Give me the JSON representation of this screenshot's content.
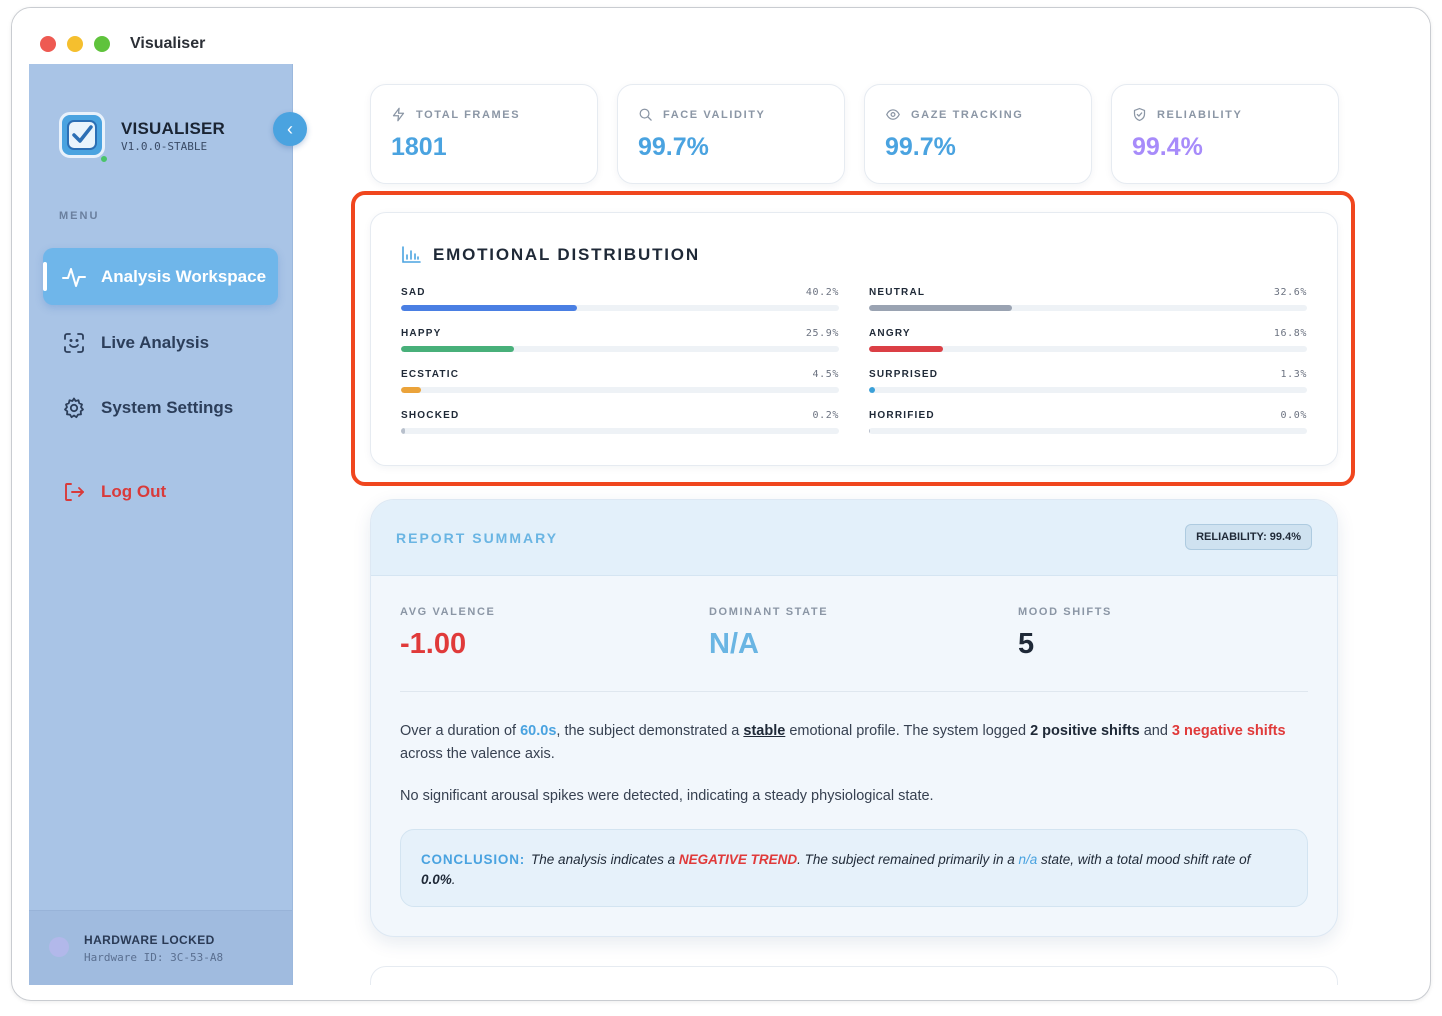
{
  "window": {
    "title": "Visualiser"
  },
  "sidebar": {
    "brand": "VISUALISER",
    "version": "V1.0.0-STABLE",
    "collapse_icon": "chevron-left-icon",
    "menu_label": "MENU",
    "items": [
      {
        "label": "Analysis Workspace",
        "icon": "activity-icon",
        "active": true
      },
      {
        "label": "Live Analysis",
        "icon": "face-scan-icon",
        "active": false
      },
      {
        "label": "System Settings",
        "icon": "gear-icon",
        "active": false
      }
    ],
    "logout": {
      "label": "Log Out",
      "icon": "logout-icon"
    },
    "hardware": {
      "title": "HARDWARE LOCKED",
      "id": "Hardware ID: 3C-53-A8"
    }
  },
  "stats": [
    {
      "label": "TOTAL FRAMES",
      "value": "1801",
      "icon": "lightning-icon",
      "color": "#4aa3e0"
    },
    {
      "label": "FACE VALIDITY",
      "value": "99.7%",
      "icon": "search-icon",
      "color": "#4aa3e0"
    },
    {
      "label": "GAZE TRACKING",
      "value": "99.7%",
      "icon": "eye-icon",
      "color": "#4aa3e0"
    },
    {
      "label": "RELIABILITY",
      "value": "99.4%",
      "icon": "shield-check-icon",
      "color": "#a78bfa"
    }
  ],
  "emotions": {
    "title": "EMOTIONAL DISTRIBUTION",
    "icon": "bar-chart-icon",
    "items": [
      {
        "label": "SAD",
        "percent": "40.2%",
        "value": 40.2,
        "color": "#4a7fe3"
      },
      {
        "label": "NEUTRAL",
        "percent": "32.6%",
        "value": 32.6,
        "color": "#9aa3b2"
      },
      {
        "label": "HAPPY",
        "percent": "25.9%",
        "value": 25.9,
        "color": "#48b07a"
      },
      {
        "label": "ANGRY",
        "percent": "16.8%",
        "value": 16.8,
        "color": "#db3f45"
      },
      {
        "label": "ECSTATIC",
        "percent": "4.5%",
        "value": 4.5,
        "color": "#eba33a"
      },
      {
        "label": "SURPRISED",
        "percent": "1.3%",
        "value": 1.3,
        "color": "#3aa0d8"
      },
      {
        "label": "SHOCKED",
        "percent": "0.2%",
        "value": 0.2,
        "color": "#b8c0cc"
      },
      {
        "label": "HORRIFIED",
        "percent": "0.0%",
        "value": 0.0,
        "color": "#b8c0cc"
      }
    ]
  },
  "report": {
    "title": "REPORT SUMMARY",
    "reliability_badge": "RELIABILITY: 99.4%",
    "metrics": [
      {
        "label": "AVG VALENCE",
        "value": "-1.00",
        "color": "#e03a3a"
      },
      {
        "label": "DOMINANT STATE",
        "value": "N/A",
        "color": "#6ab5e3"
      },
      {
        "label": "MOOD SHIFTS",
        "value": "5",
        "color": "#1f2937"
      }
    ],
    "p1": {
      "t1": "Over a duration of ",
      "duration": "60.0s",
      "t2": ", the subject demonstrated a ",
      "stability": "stable",
      "t3": " emotional profile. The system logged ",
      "positive": "2 positive shifts",
      "t4": " and ",
      "negative": "3 negative shifts",
      "t5": " across the valence axis."
    },
    "p2": "No significant arousal spikes were detected, indicating a steady physiological state.",
    "conclusion": {
      "label": "CONCLUSION:",
      "t1": "The analysis indicates a ",
      "trend": "NEGATIVE TREND",
      "t2": ". The subject remained primarily in a ",
      "state": "n/a",
      "t3": " state, with a total mood shift rate of ",
      "rate": "0.0%",
      "t4": "."
    }
  }
}
